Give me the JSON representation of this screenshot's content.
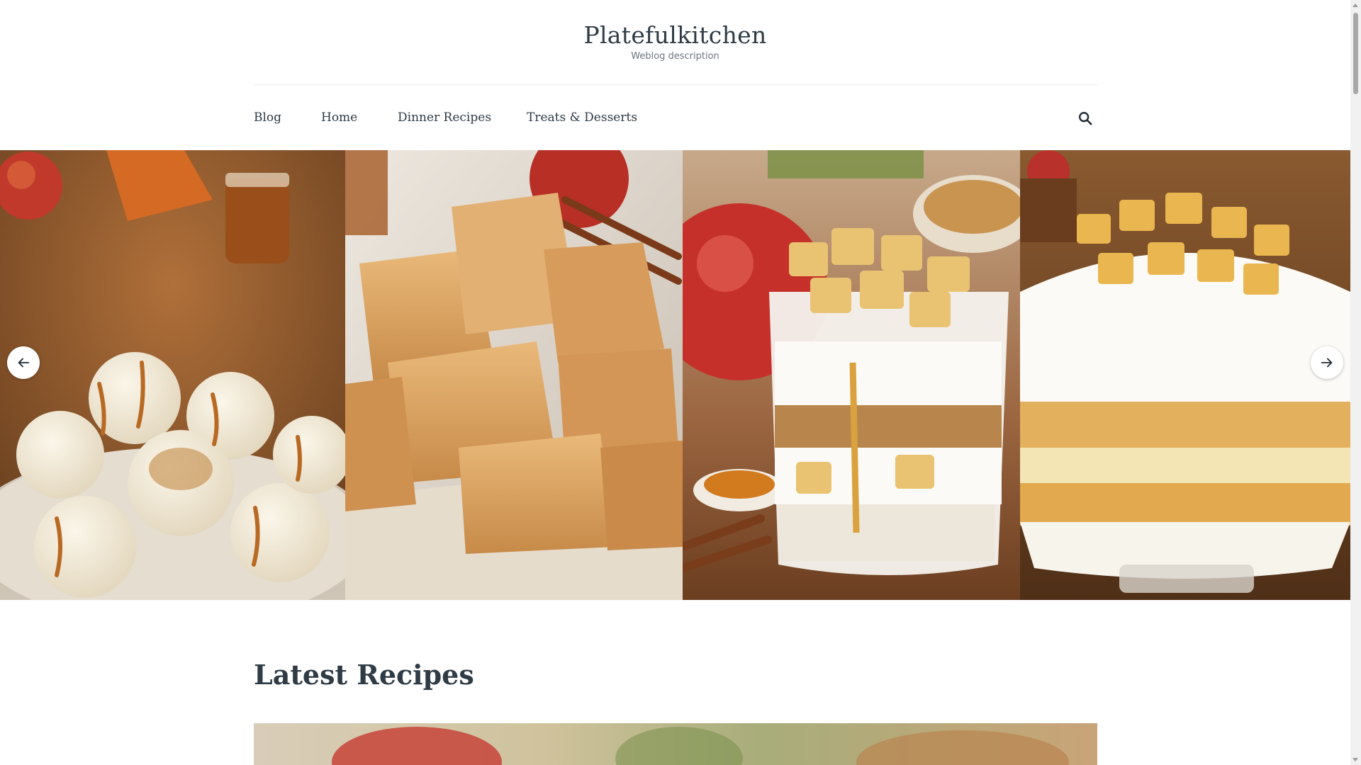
{
  "site": {
    "title": "Platefulkitchen",
    "description": "Weblog description"
  },
  "nav": {
    "items": [
      {
        "label": "Blog"
      },
      {
        "label": "Home"
      },
      {
        "label": "Dinner Recipes"
      },
      {
        "label": "Treats & Desserts"
      }
    ],
    "search_icon": "search-icon"
  },
  "slider": {
    "slides": [
      {
        "image": "white chocolate caramel truffles with cookie crumbs"
      },
      {
        "image": "caramel apple fudge squares with cinnamon"
      },
      {
        "image": "apple crisp yogurt parfait"
      },
      {
        "image": "apple pie trifle with whipped cream"
      }
    ],
    "prev_icon": "arrow-left-icon",
    "next_icon": "arrow-right-icon"
  },
  "latest": {
    "title": "Latest Recipes"
  },
  "colors": {
    "text": "#2f3b45",
    "muted": "#6b7680",
    "rule": "#ececec"
  }
}
